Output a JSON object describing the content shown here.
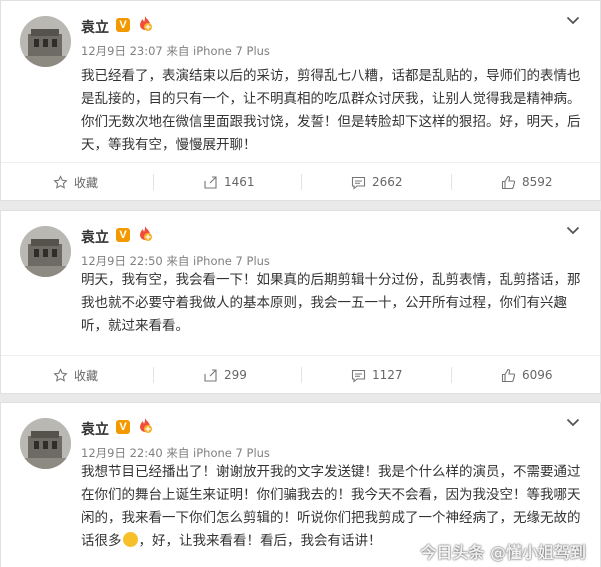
{
  "posts": [
    {
      "author": "袁立",
      "verified_badge": "V",
      "meta": "12月9日 23:07 来自 iPhone 7 Plus",
      "text": "我已经看了，表演结束以后的采访，剪得乱七八糟，话都是乱贴的，导师们的表情也是乱接的，目的只有一个，让不明真相的吃瓜群众讨厌我，让别人觉得我是精神病。你们无数次地在微信里面跟我讨饶，发誓！但是转脸却下这样的狠招。好，明天，后天，等我有空，慢慢展开聊！",
      "actions": {
        "favorite": "收藏",
        "reposts": "1461",
        "comments": "2662",
        "likes": "8592"
      }
    },
    {
      "author": "袁立",
      "verified_badge": "V",
      "meta": "12月9日 22:50 来自 iPhone 7 Plus",
      "text": "明天，我有空，我会看一下！如果真的后期剪辑十分过份，乱剪表情，乱剪搭话，那我也就不必要守着我做人的基本原则，我会一五一十，公开所有过程，你们有兴趣听，就过来看看。",
      "actions": {
        "favorite": "收藏",
        "reposts": "299",
        "comments": "1127",
        "likes": "6096"
      }
    },
    {
      "author": "袁立",
      "verified_badge": "V",
      "meta": "12月9日 22:40 来自 iPhone 7 Plus",
      "text_before_emoji": "我想节目已经播出了！谢谢放开我的文字发送键！我是个什么样的演员，不需要通过在你们的舞台上诞生来证明！你们骗我去的！我今天不会看，因为我没空！等我哪天闲的，我来看一下你们怎么剪辑的！听说你们把我剪成了一个神经病了，无缘无故的话很多",
      "text_after_emoji": "，好，让我来看看！看后，我会有话讲！"
    }
  ],
  "watermark": "今日头条 @懂小姐驾到",
  "icons": {
    "favorite": "star-icon",
    "repost": "repost-icon",
    "comment": "comment-icon",
    "like": "thumbs-up-icon",
    "menu": "chevron-down-icon"
  },
  "colors": {
    "badge": "#f29900",
    "text": "#333333",
    "meta": "#808080"
  }
}
